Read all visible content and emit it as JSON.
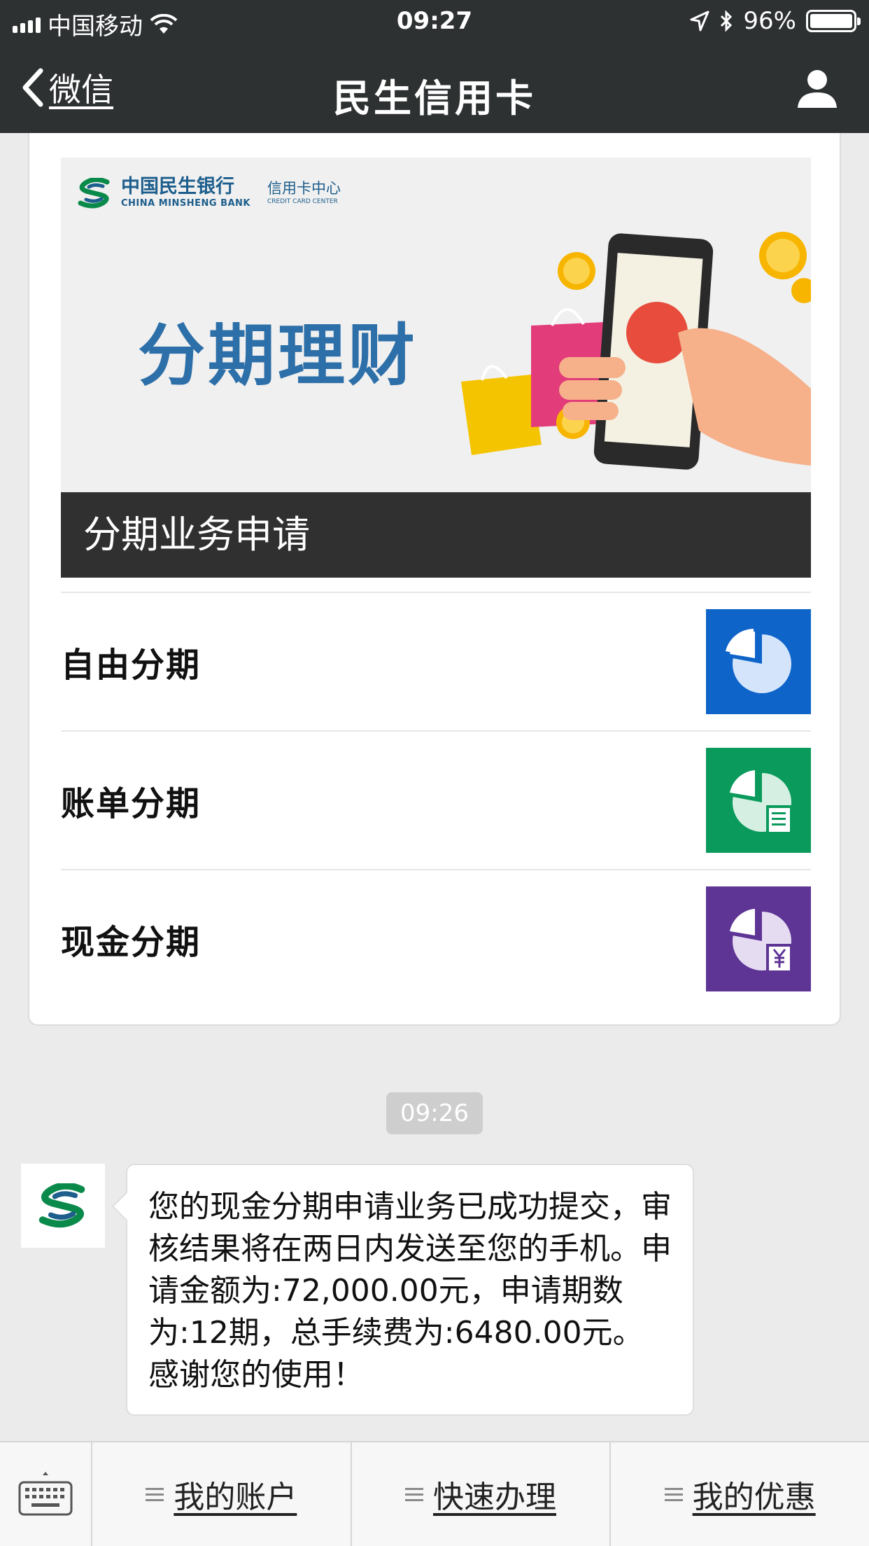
{
  "status_bar": {
    "carrier": "中国移动",
    "time": "09:27",
    "battery": "96%"
  },
  "nav": {
    "back_label": "微信",
    "title": "民生信用卡",
    "profile_icon": "user-icon"
  },
  "card": {
    "bank_name_cn": "中国民生银行",
    "bank_name_en": "CHINA MINSHENG BANK",
    "center_cn": "信用卡中心",
    "center_en": "CREDIT CARD CENTER",
    "banner_title": "分期理财",
    "banner_caption": "分期业务申请",
    "items": [
      {
        "label": "自由分期",
        "icon": "pie-chart-icon",
        "color": "#0e64c9"
      },
      {
        "label": "账单分期",
        "icon": "pie-chart-bill-icon",
        "color": "#0a9a5c"
      },
      {
        "label": "现金分期",
        "icon": "pie-chart-yuan-icon",
        "color": "#5e3495"
      }
    ]
  },
  "chat": {
    "timestamp": "09:26",
    "message": "您的现金分期申请业务已成功提交，审核结果将在两日内发送至您的手机。申请金额为:72,000.00元，申请期数为:12期，总手续费为:6480.00元。感谢您的使用！"
  },
  "bottom_menu": {
    "keyboard_icon": "keyboard-icon",
    "items": [
      {
        "label": "我的账户"
      },
      {
        "label": "快速办理"
      },
      {
        "label": "我的优惠"
      }
    ]
  }
}
